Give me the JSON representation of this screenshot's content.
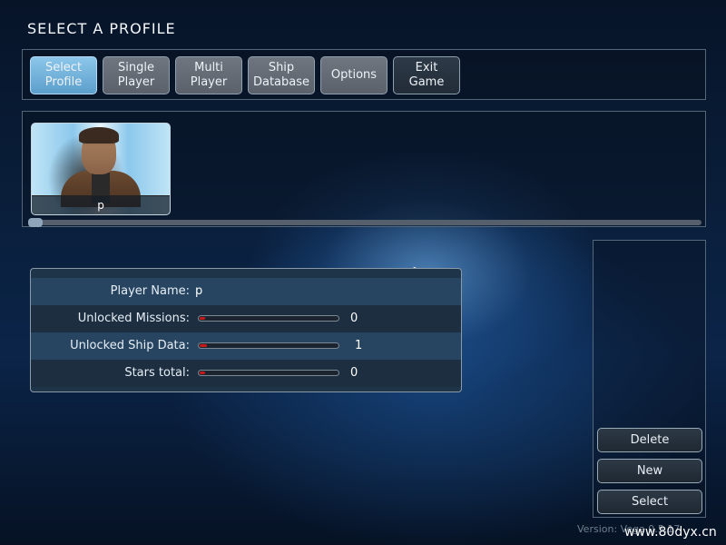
{
  "screen": {
    "title": "SELECT A PROFILE",
    "version": "Version: Vega 0.5.17",
    "watermark": "www.80dyx.cn"
  },
  "menu": {
    "buttons": [
      {
        "label": "Select\nProfile",
        "state": "active"
      },
      {
        "label": "Single\nPlayer",
        "state": "normal"
      },
      {
        "label": "Multi\nPlayer",
        "state": "normal"
      },
      {
        "label": "Ship\nDatabase",
        "state": "normal"
      },
      {
        "label": "Options",
        "state": "normal"
      },
      {
        "label": "Exit\nGame",
        "state": "dark"
      }
    ]
  },
  "profiles": [
    {
      "name": "p",
      "selected": true
    }
  ],
  "stats": {
    "player_name_label": "Player Name:",
    "player_name": "p",
    "rows": [
      {
        "label": "Unlocked Missions:",
        "value": "0",
        "fill_fraction": 0.04
      },
      {
        "label": "Unlocked Ship Data:",
        "value": "1",
        "fill_fraction": 0.05
      },
      {
        "label": "Stars total:",
        "value": "0",
        "fill_fraction": 0.04
      }
    ]
  },
  "side_actions": {
    "delete_label": "Delete",
    "new_label": "New",
    "select_label": "Select"
  },
  "colors": {
    "active_tab": "#6fb3dd",
    "progress_fill": "#c81818"
  }
}
